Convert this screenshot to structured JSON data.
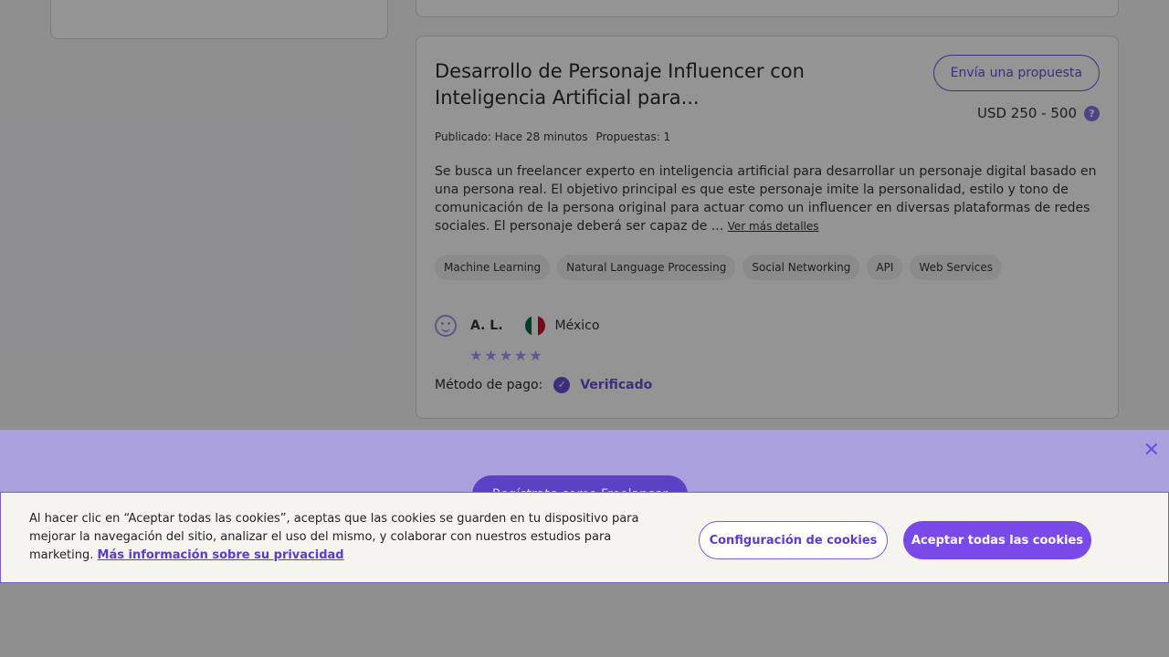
{
  "job": {
    "title": "Desarrollo de Personaje Influencer con Inteligencia Artificial para...",
    "propose_button": "Envía una propuesta",
    "budget": "USD 250 - 500",
    "help_symbol": "?",
    "published": "Publicado: Hace 28 minutos",
    "proposals": "Propuestas: 1",
    "description": "Se busca un freelancer experto en inteligencia artificial para desarrollar un personaje digital basado en una persona real. El objetivo principal es que este personaje imite la personalidad, estilo y tono de comunicación de la persona original para actuar como un influencer en diversas plataformas de redes sociales. El personaje deberá ser capaz de ...",
    "more_link": "Ver más detalles",
    "tags": [
      "Machine Learning",
      "Natural Language Processing",
      "Social Networking",
      "API",
      "Web Services"
    ],
    "client": {
      "name": "A. L.",
      "country": "México",
      "flag_colors": [
        "#006847",
        "#ffffff",
        "#ce1126"
      ],
      "rating_stars": [
        "★",
        "★",
        "★",
        "★",
        "★"
      ]
    },
    "payment_label": "Método de pago:",
    "payment_check": "✓",
    "payment_status": "Verificado"
  },
  "promo": {
    "button": "Regístrate como Freelancer",
    "close_symbol": "✕"
  },
  "cookie_banner": {
    "text": "Al hacer clic en “Aceptar todas las cookies”, aceptas que las cookies se guarden en tu dispositivo para mejorar la navegación del sitio, analizar el uso del mismo, y colaborar con nuestros estudios para marketing.",
    "privacy_link": "Más información sobre su privacidad",
    "settings_button": "Configuración de cookies",
    "accept_button": "Aceptar todas las cookies"
  },
  "colors": {
    "accent": "#6b4fd8",
    "overlay": "rgba(0,0,0,0.42)",
    "cookie_background": "#f6f4ee"
  }
}
